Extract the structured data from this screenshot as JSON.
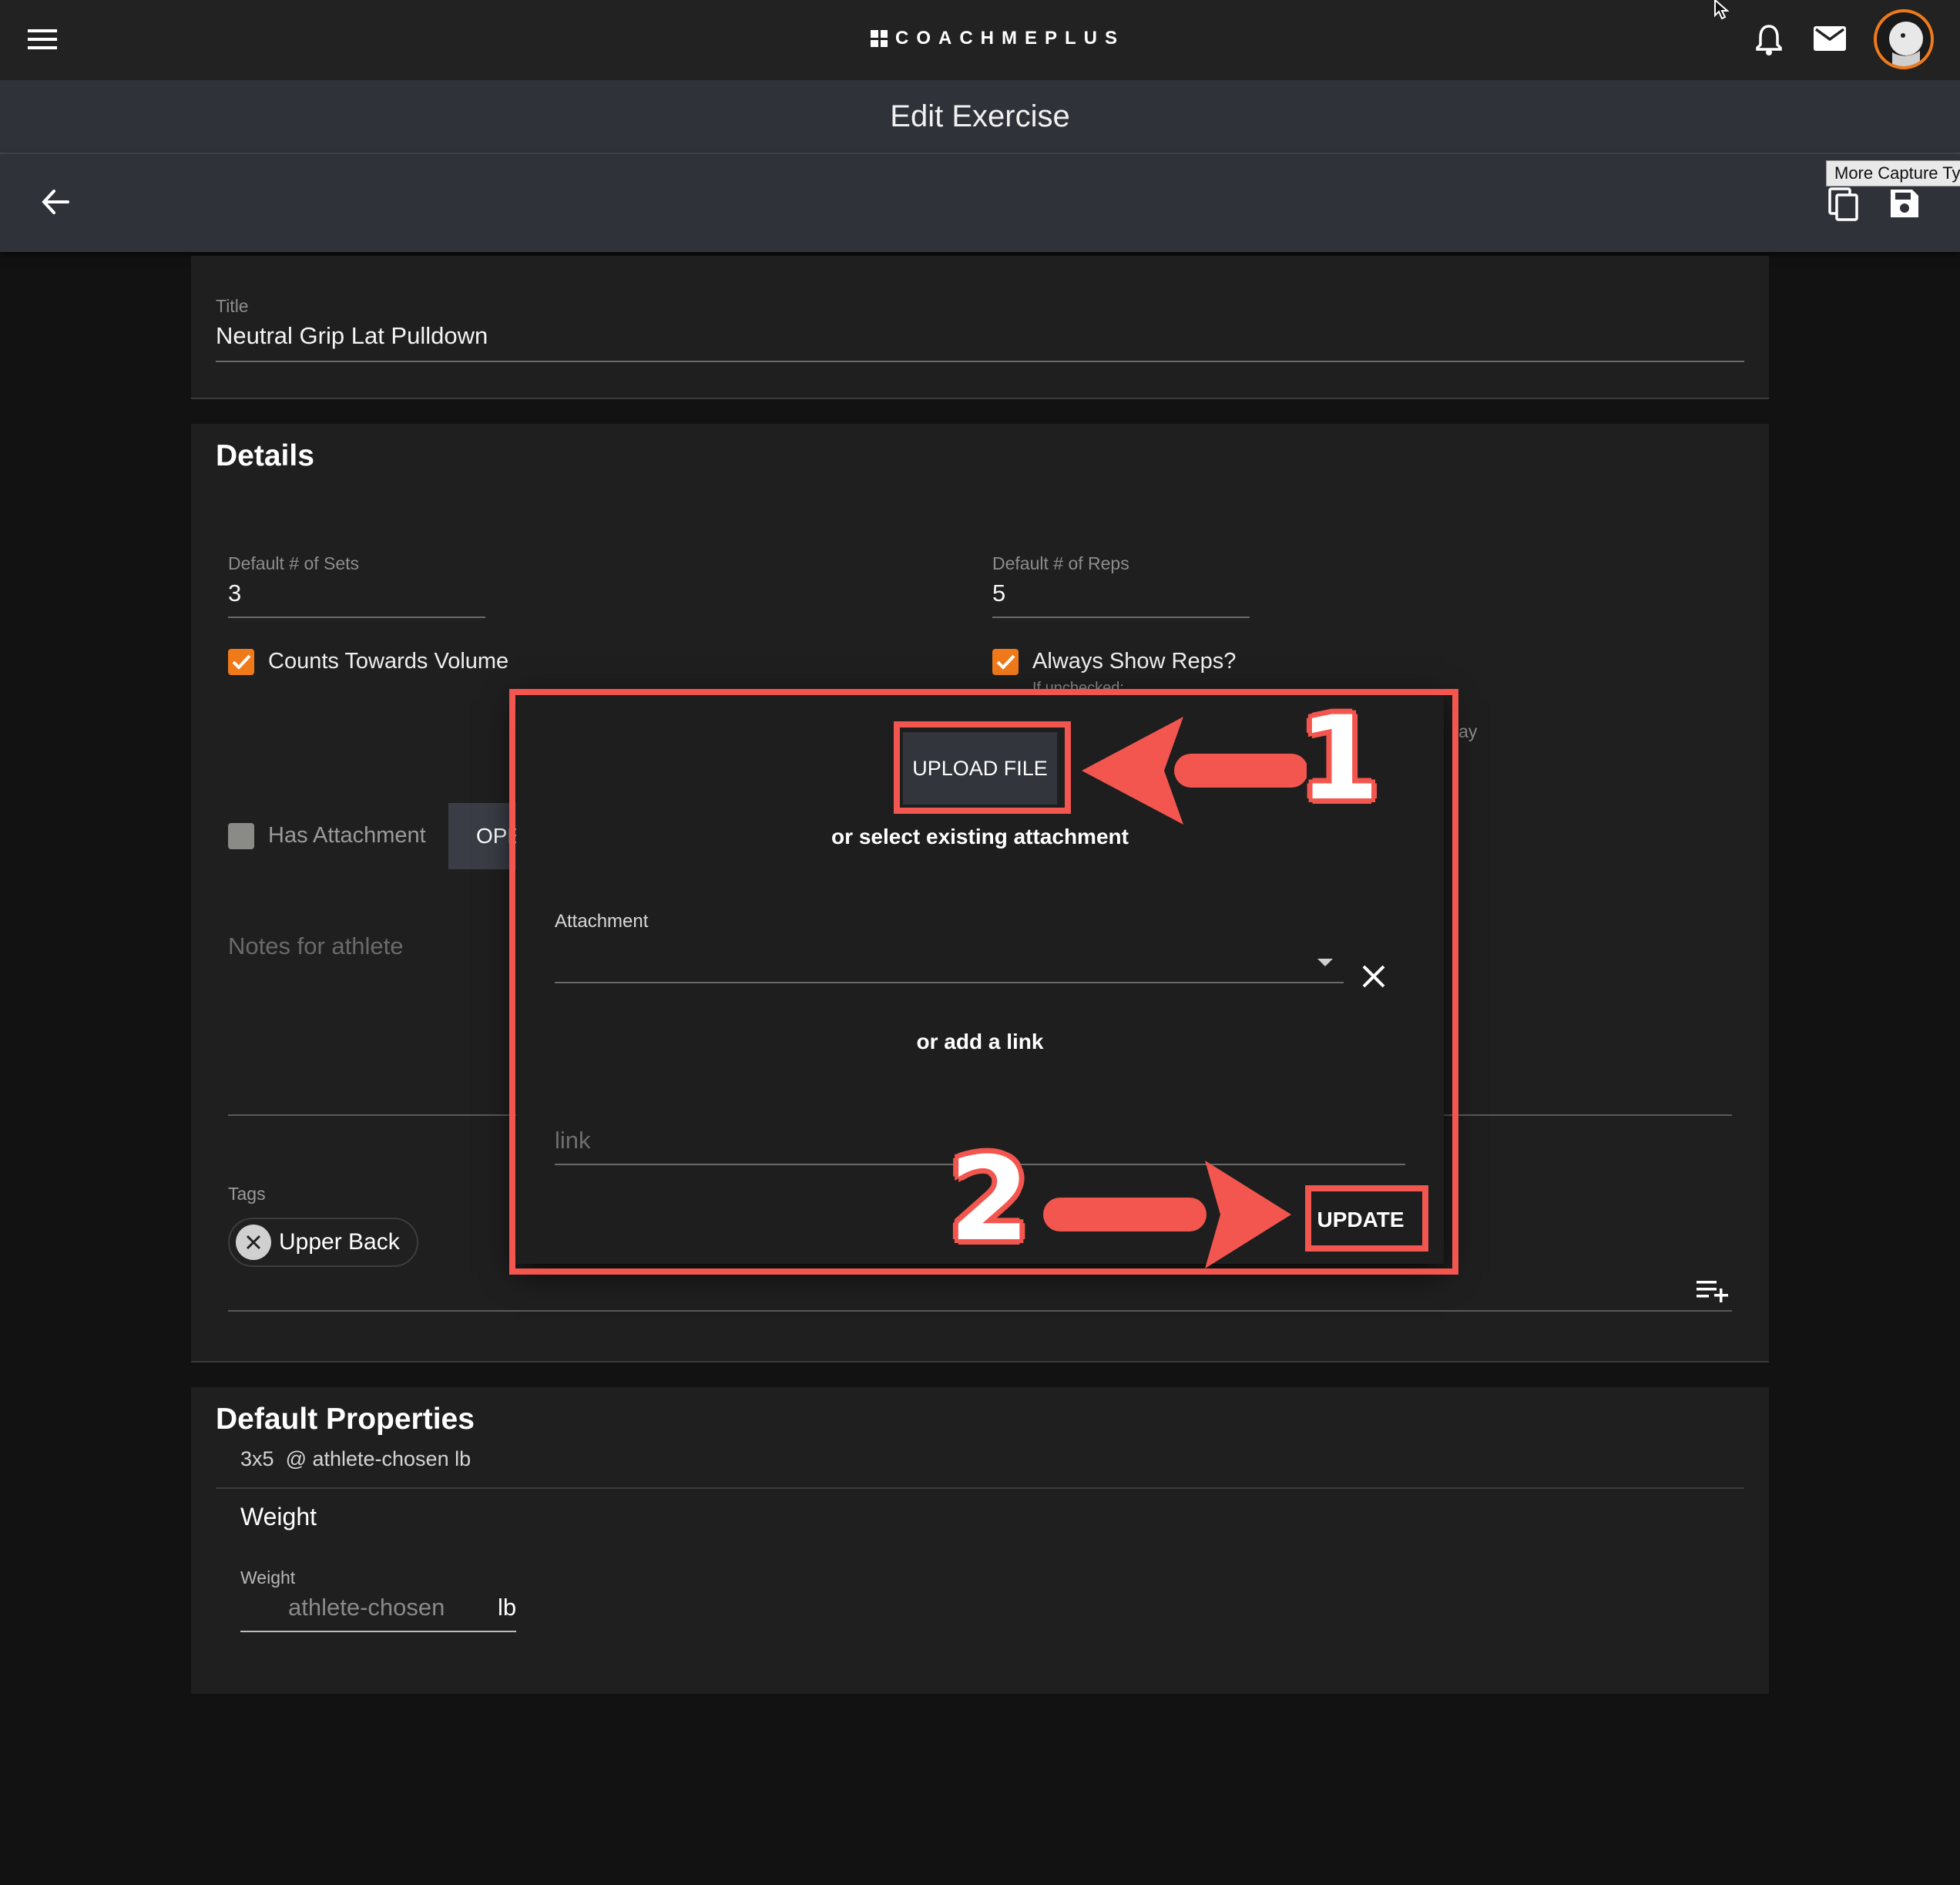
{
  "header": {
    "logo_text": "COACHMEPLUS",
    "page_title": "Edit Exercise",
    "tooltip": "More Capture Ty",
    "icons": [
      "menu-icon",
      "bell-icon",
      "mail-icon",
      "avatar",
      "back-arrow-icon",
      "copy-icon",
      "save-icon"
    ]
  },
  "title_field": {
    "label": "Title",
    "value": "Neutral Grip Lat Pulldown"
  },
  "details": {
    "heading": "Details",
    "sets_label": "Default # of Sets",
    "sets_value": "3",
    "reps_label": "Default # of Reps",
    "reps_value": "5",
    "counts_volume_label": "Counts Towards Volume",
    "counts_volume_checked": true,
    "always_show_reps_label": "Always Show Reps?",
    "always_show_reps_checked": true,
    "always_show_reps_hint": "If unchecked:",
    "hint_tail": "lay",
    "has_attachment_label": "Has Attachment",
    "has_attachment_checked": false,
    "open_button_label": "OPE",
    "notes_placeholder": "Notes for athlete",
    "tags_label": "Tags",
    "tags": [
      "Upper Back"
    ]
  },
  "default_properties": {
    "heading": "Default Properties",
    "summary_sets": "3x5",
    "summary_weight": "@ athlete-chosen lb",
    "weight_heading": "Weight",
    "weight_label": "Weight",
    "weight_value": "athlete-chosen",
    "weight_unit": "lb"
  },
  "dialog": {
    "upload_label": "UPLOAD FILE",
    "or_select_text": "or select existing attachment",
    "attachment_label": "Attachment",
    "or_link_text": "or add a link",
    "link_placeholder": "link",
    "update_label": "UPDATE"
  },
  "annotations": {
    "step1": "1",
    "step2": "2",
    "color": "#f2564f"
  },
  "colors": {
    "accent": "#f07a1a",
    "annotation": "#f2564f",
    "background": "#121212"
  }
}
